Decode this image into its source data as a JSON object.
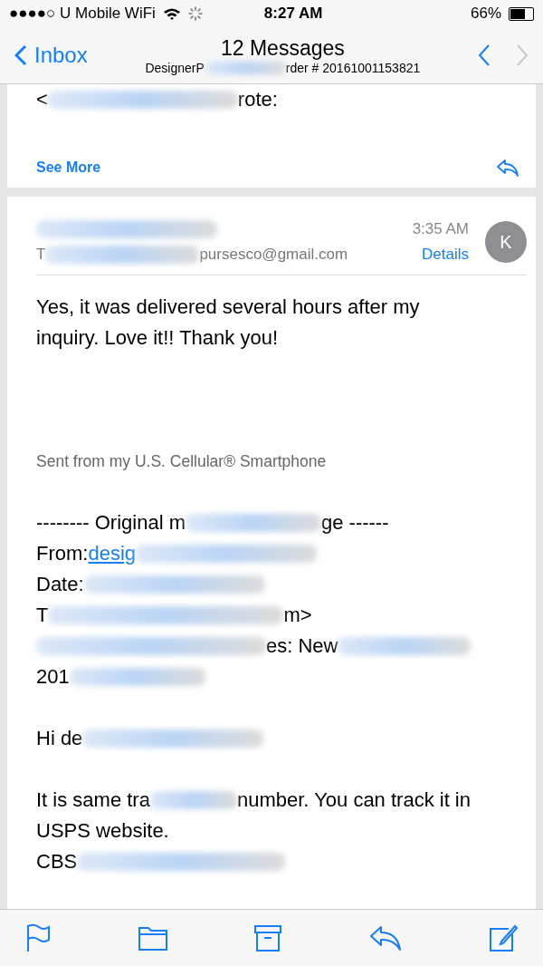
{
  "status_bar": {
    "carrier": "●●●●○ U Mobile WiFi",
    "time": "8:27 AM",
    "battery": "66%"
  },
  "nav": {
    "back": "Inbox",
    "title": "12 Messages",
    "subtitle": [
      {
        "kind": "text",
        "text": "DesignerP"
      },
      {
        "kind": "blur"
      },
      {
        "kind": "text",
        "text": "rder # 20161001153821"
      }
    ]
  },
  "previous_message": {
    "quote_line": [
      {
        "kind": "text",
        "text": "<"
      },
      {
        "kind": "blur"
      },
      {
        "kind": "text",
        "text": "rote:"
      }
    ],
    "see_more": "See More"
  },
  "message": {
    "sender": [
      {
        "kind": "blur"
      }
    ],
    "to_line": [
      {
        "kind": "text",
        "text": "T"
      },
      {
        "kind": "blur"
      },
      {
        "kind": "text",
        "text": "pursesco@gmail.com"
      }
    ],
    "time": "3:35 AM",
    "details": "Details",
    "avatar": "K",
    "body": [
      {
        "kind": "main",
        "parts": [
          {
            "kind": "text",
            "text": "Yes, it was delivered several hours after my inquiry. Love it!! Thank you!"
          }
        ]
      },
      {
        "kind": "gap"
      },
      {
        "kind": "signature",
        "parts": [
          {
            "kind": "text",
            "text": "Sent from my U.S. Cellular® Smartphone"
          }
        ]
      },
      {
        "kind": "gap"
      },
      {
        "kind": "line",
        "parts": [
          {
            "kind": "text",
            "text": "-------- Original m"
          },
          {
            "kind": "blur"
          },
          {
            "kind": "text",
            "text": "ge ------"
          }
        ]
      },
      {
        "kind": "line",
        "parts": [
          {
            "kind": "text",
            "text": "From: "
          },
          {
            "kind": "link",
            "text": "desig"
          },
          {
            "kind": "blur"
          }
        ]
      },
      {
        "kind": "line",
        "parts": [
          {
            "kind": "text",
            "text": "Date: "
          },
          {
            "kind": "blur"
          }
        ]
      },
      {
        "kind": "line",
        "parts": [
          {
            "kind": "text",
            "text": "T"
          },
          {
            "kind": "blur"
          },
          {
            "kind": "text",
            "text": "m>"
          }
        ]
      },
      {
        "kind": "line",
        "parts": [
          {
            "kind": "blur"
          },
          {
            "kind": "text",
            "text": "es: New"
          },
          {
            "kind": "blur"
          }
        ]
      },
      {
        "kind": "line",
        "parts": [
          {
            "kind": "text",
            "text": "201"
          },
          {
            "kind": "blur"
          }
        ]
      },
      {
        "kind": "gap"
      },
      {
        "kind": "line",
        "parts": [
          {
            "kind": "text",
            "text": "Hi de"
          },
          {
            "kind": "blur"
          }
        ]
      },
      {
        "kind": "gap"
      },
      {
        "kind": "line",
        "parts": [
          {
            "kind": "text",
            "text": "It is same tra"
          },
          {
            "kind": "blur"
          },
          {
            "kind": "text",
            "text": "number. You can track it in"
          }
        ]
      },
      {
        "kind": "line",
        "parts": [
          {
            "kind": "text",
            "text": "USPS website."
          }
        ]
      },
      {
        "kind": "line",
        "parts": [
          {
            "kind": "text",
            "text": "CBS"
          },
          {
            "kind": "blur"
          }
        ]
      }
    ]
  }
}
